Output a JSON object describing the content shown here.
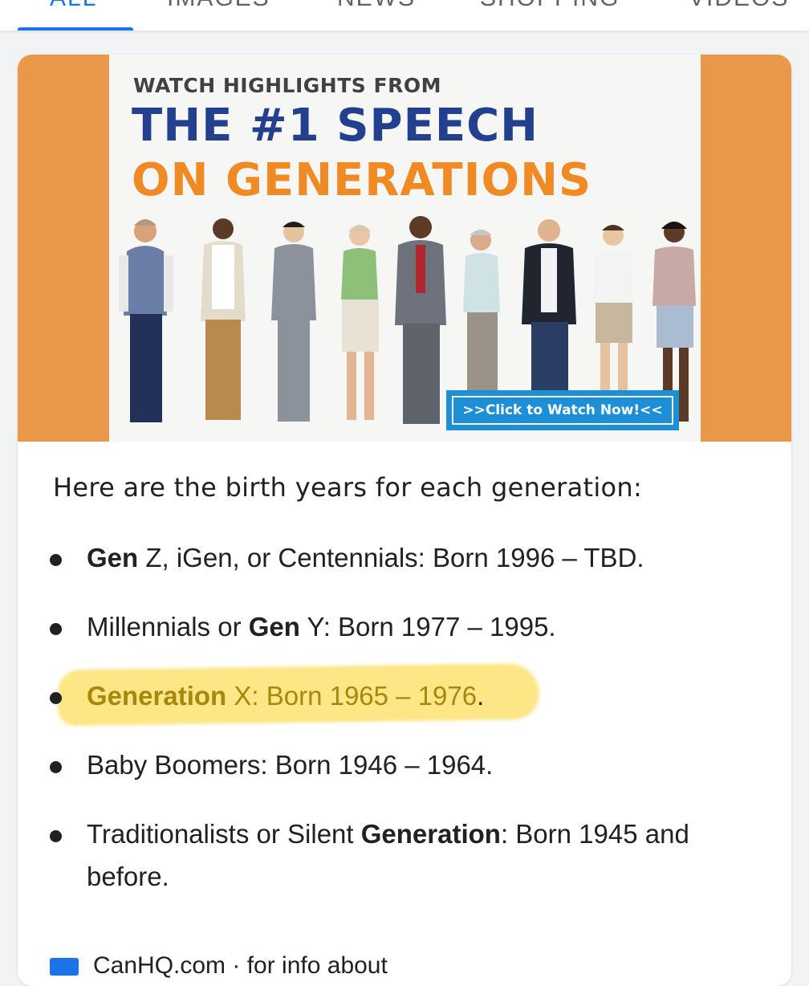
{
  "tabs": [
    {
      "label": "ALL",
      "active": true
    },
    {
      "label": "IMAGES",
      "active": false
    },
    {
      "label": "NEWS",
      "active": false
    },
    {
      "label": "SHOPPING",
      "active": false
    },
    {
      "label": "VIDEOS",
      "active": false
    }
  ],
  "banner": {
    "line1": "WATCH HIGHLIGHTS FROM",
    "line2": "THE #1 SPEECH",
    "line3": "ON GENERATIONS",
    "button": ">>Click to Watch Now!<<",
    "colors": {
      "frame": "#e9984a",
      "title_blue": "#23408e",
      "title_orange": "#ef8a25",
      "button": "#1d8fd6"
    }
  },
  "content": {
    "intro": "Here are the birth years for each generation:",
    "items": [
      {
        "bold": "Gen",
        "rest": " Z, iGen, or Centennials: Born 1996 – TBD.",
        "pre": ""
      },
      {
        "pre": "Millennials or ",
        "bold": "Gen",
        "rest": " Y: Born 1977 – 1995."
      },
      {
        "pre": "",
        "bold": "Generation",
        "rest": " X: Born 1965 – 1976",
        "tail": ".",
        "highlighted": true
      },
      {
        "pre": "Baby Boomers: Born 1946 – 1964.",
        "bold": "",
        "rest": ""
      },
      {
        "pre": "Traditionalists or Silent ",
        "bold": "Generation",
        "rest": ": Born 1945 and before."
      }
    ],
    "highlight_color": "#fad63c"
  },
  "source": {
    "text": "CanHQ.com · for info about"
  }
}
